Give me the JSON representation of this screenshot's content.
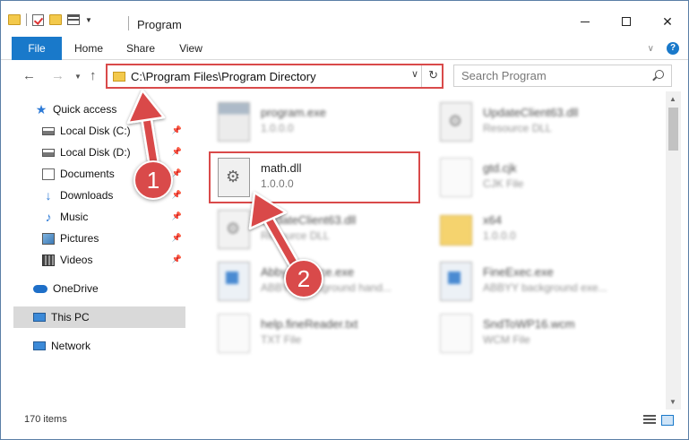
{
  "window": {
    "title": "Program"
  },
  "ribbon": {
    "tabs": [
      "File",
      "Home",
      "Share",
      "View"
    ]
  },
  "address": {
    "path": "C:\\Program Files\\Program Directory",
    "search_placeholder": "Search Program"
  },
  "nav": {
    "items": [
      {
        "label": "Quick access"
      },
      {
        "label": "Local Disk (C:)"
      },
      {
        "label": "Local Disk (D:)"
      },
      {
        "label": "Documents"
      },
      {
        "label": "Downloads"
      },
      {
        "label": "Music"
      },
      {
        "label": "Pictures"
      },
      {
        "label": "Videos"
      },
      {
        "label": "OneDrive"
      },
      {
        "label": "This PC"
      },
      {
        "label": "Network"
      }
    ]
  },
  "files": [
    {
      "name": "program.exe",
      "sub": "1.0.0.0"
    },
    {
      "name": "UpdateClient63.dll",
      "sub": "Resource DLL"
    },
    {
      "name": "math.dll",
      "sub": "1.0.0.0"
    },
    {
      "name": "gtd.cjk",
      "sub": "CJK File"
    },
    {
      "name": "UpdateClient63.dll",
      "sub": "Resource DLL"
    },
    {
      "name": "x64",
      "sub": "1.0.0.0"
    },
    {
      "name": "AbbyyService.exe",
      "sub": "ABBYY background hand..."
    },
    {
      "name": "FineExec.exe",
      "sub": "ABBYY background exe..."
    },
    {
      "name": "help.fineReader.txt",
      "sub": "TXT File"
    },
    {
      "name": "SndToWP16.wcm",
      "sub": "WCM File"
    }
  ],
  "status": {
    "count": "170 items"
  },
  "annotations": {
    "badge1": "1",
    "badge2": "2"
  },
  "colors": {
    "accent": "#1979ca",
    "highlight": "#d94a4a"
  }
}
